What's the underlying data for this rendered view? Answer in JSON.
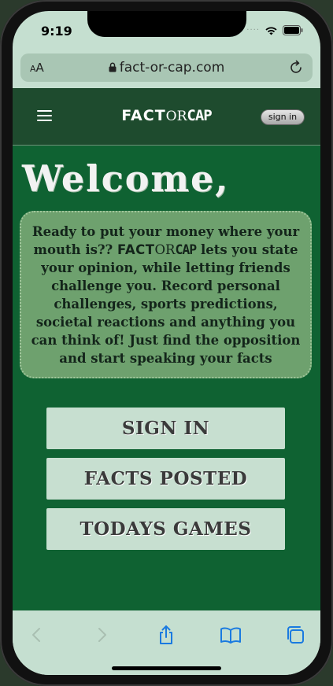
{
  "status_bar": {
    "time": "9:19",
    "signal_icon": "signal-dots-icon",
    "wifi_icon": "wifi-icon",
    "battery_icon": "battery-icon"
  },
  "browser": {
    "text_size_label_small": "A",
    "text_size_label_large": "A",
    "url": "fact-or-cap.com",
    "lock_icon": "lock-icon",
    "reload_icon": "reload-icon"
  },
  "navbar": {
    "menu_icon": "hamburger-menu-icon",
    "brand_fact": "FACT",
    "brand_or": "OR",
    "brand_cap": "CAP",
    "sign_in_label": "sign in"
  },
  "main": {
    "welcome": "Welcome,",
    "intro_before": "Ready to put your money where your mouth is?? ",
    "intro_brand_fact": "FACT",
    "intro_brand_or": "OR",
    "intro_brand_cap": "CAP",
    "intro_after": " lets you state your opinion, while letting friends challenge you. Record personal challenges, sports predictions, societal reactions and anything you can think of! Just find the opposition and start speaking your facts",
    "buttons": [
      {
        "label": "SIGN IN"
      },
      {
        "label": "FACTS POSTED"
      },
      {
        "label": "TODAYS GAMES"
      }
    ]
  },
  "toolbar": {
    "back_icon": "chevron-left-icon",
    "forward_icon": "chevron-right-icon",
    "share_icon": "share-icon",
    "bookmarks_icon": "book-icon",
    "tabs_icon": "tabs-icon"
  },
  "colors": {
    "page_bg": "#0f6232",
    "navbar_bg": "#1e4b2e",
    "panel_bg": "#6ea16e",
    "button_bg": "#c7dfd0",
    "chrome_bg": "#c5dfd0",
    "accent_blue": "#1a7ae0"
  }
}
